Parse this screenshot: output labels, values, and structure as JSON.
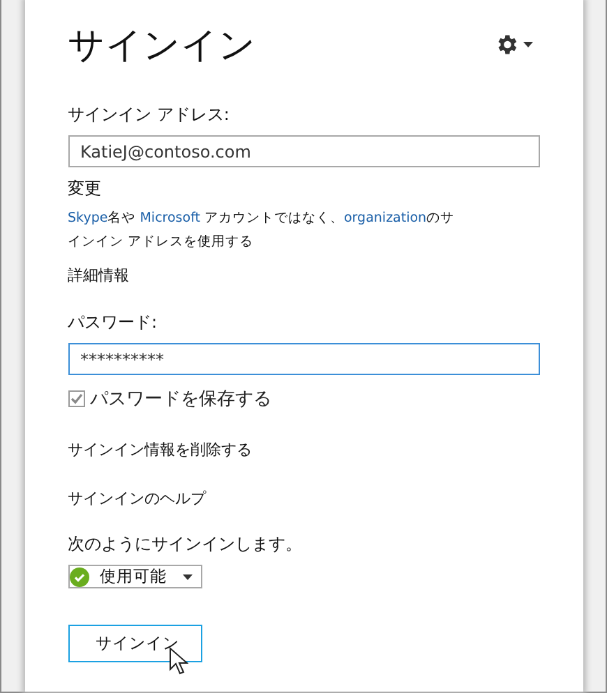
{
  "title": "サインイン",
  "address": {
    "label": "サインイン アドレス:",
    "value": "KatieJ@contoso.com"
  },
  "change_link": "変更",
  "note": [
    {
      "text": "Skype",
      "link": true
    },
    {
      "text": "名や ",
      "link": false
    },
    {
      "text": "Microsoft",
      "link": true
    },
    {
      "text": " アカウントではなく、",
      "link": false
    },
    {
      "text": "organization",
      "link": true
    },
    {
      "text": "のサインイン アドレスを使用する",
      "link": false
    }
  ],
  "details_link": "詳細情報",
  "password": {
    "label": "パスワード:",
    "value": "**********",
    "focused": true
  },
  "remember_password": {
    "label": "パスワードを保存する",
    "checked": true
  },
  "delete_link": "サインイン情報を削除する",
  "help_link": "サインインのヘルプ",
  "status_label": "次のようにサインインします。",
  "status": {
    "label": "使用可能",
    "color": "#6aad1f"
  },
  "sign_in_button": "サインイン"
}
